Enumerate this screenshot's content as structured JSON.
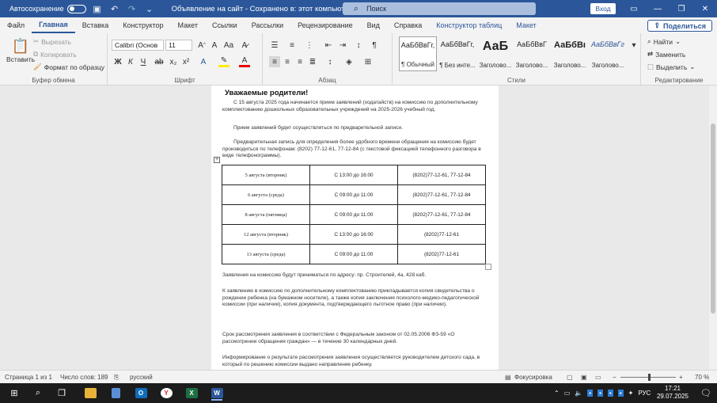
{
  "titlebar": {
    "autosave_label": "Автосохранение",
    "autosave_state": "Откл.",
    "doc_title": "Объявление на сайт  -  Сохранено в: этот компьютер",
    "search_placeholder": "Поиск",
    "signin_label": "Вход"
  },
  "tabs": [
    "Файл",
    "Главная",
    "Вставка",
    "Конструктор",
    "Макет",
    "Ссылки",
    "Рассылки",
    "Рецензирование",
    "Вид",
    "Справка",
    "Конструктор таблиц",
    "Макет"
  ],
  "active_tab": "Главная",
  "share_label": "Поделиться",
  "ribbon": {
    "clipboard": {
      "paste_label": "Вставить",
      "cut_label": "Вырезать",
      "copy_label": "Копировать",
      "format_painter_label": "Формат по образцу",
      "group_label": "Буфер обмена"
    },
    "font": {
      "font_name": "Calibri (Основ",
      "font_size": "11",
      "group_label": "Шрифт",
      "bold": "Ж",
      "italic": "К",
      "underline": "Ч"
    },
    "paragraph": {
      "group_label": "Абзац"
    },
    "styles": {
      "group_label": "Стили",
      "items": [
        {
          "preview": "АаБбВвГг,",
          "name": "¶ Обычный"
        },
        {
          "preview": "АаБбВвГг,",
          "name": "¶ Без инте..."
        },
        {
          "preview": "АаБ",
          "name": "Заголово..."
        },
        {
          "preview": "АаБбВвГ",
          "name": "Заголово..."
        },
        {
          "preview": "АаБбВı",
          "name": "Заголово..."
        },
        {
          "preview": "АаБбВвГг",
          "name": "Заголово..."
        }
      ]
    },
    "editing": {
      "group_label": "Редактирование",
      "find_label": "Найти",
      "replace_label": "Заменить",
      "select_label": "Выделить"
    }
  },
  "document": {
    "heading": "Уважаемые родители!",
    "para1": "С 15 августа 2025 года начинается прием заявлений (ходатайств) на комиссию по дополнительному комплектованию дошкольных образовательных учреждений на 2025-2026 учебный год.",
    "para2": "Прием заявлений будет осуществляться по предварительной записи.",
    "para3": "Предварительная запись для определения более удобного времени обращения на комиссию будет производиться по телефонам: (8202) 77-12-61, 77-12-84 (с текстовой фиксацией телефонного разговора в виде телефонограммы).",
    "schedule": [
      {
        "date": "5 августа (вторник)",
        "time": "С 13:00 до 16:00",
        "phone": "(8202)77-12-61, 77-12-84"
      },
      {
        "date": "6 августа (среда)",
        "time": "С 09:00 до 11:00",
        "phone": "(8202)77-12-61, 77-12-84"
      },
      {
        "date": "8 августа (пятница)",
        "time": "С 09:00 до 11:00",
        "phone": "(8202)77-12-61, 77-12-84"
      },
      {
        "date": "12 августа (вторник)",
        "time": "С 13:00 до 16:00",
        "phone": "(8202)77-12-61"
      },
      {
        "date": "13 августа (среда)",
        "time": "С 09:00 до 11:00",
        "phone": "(8202)77-12-61"
      }
    ],
    "para4": "Заявления на комиссию будут приниматься по адресу: пр. Строителей, 4а, 428 каб.",
    "para5": "К заявлению в комиссию по дополнительному комплектованию прикладывается копия свидетельства о рождении ребенка (на бумажном носителе), а также копия заключения психолого-медико-педагогической комиссии (при наличии), копия документа, подтверждающего льготное право (при наличии).",
    "para6": "Срок рассмотрения заявления в соответствии с Федеральным законом от 02.05.2006 ФЗ-59 «О рассмотрении обращения граждан» — в течение 30 календарных дней.",
    "para7": "Информирование о результате рассмотрения заявления осуществляется руководителем детского сада, в который по решению комиссии выдано направление ребенку."
  },
  "statusbar": {
    "page": "Страница 1 из 1",
    "words": "Число слов: 189",
    "language": "русский",
    "focus": "Фокусировка",
    "zoom": "70 %"
  },
  "taskbar": {
    "lang": "РУС",
    "time": "17:21",
    "date": "29.07.2025"
  }
}
